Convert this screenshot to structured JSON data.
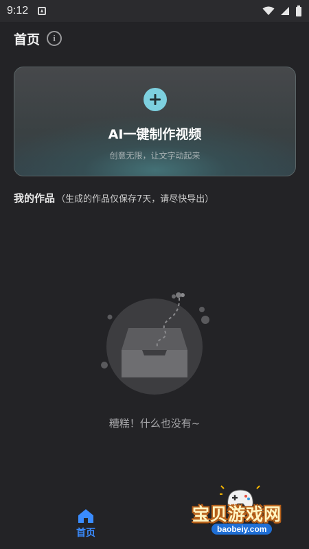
{
  "status_bar": {
    "time": "9:12",
    "icons": [
      "app-notification-icon",
      "wifi-icon",
      "signal-icon",
      "battery-icon"
    ]
  },
  "header": {
    "title": "首页",
    "info_icon": "ⓘ"
  },
  "create_card": {
    "title": "AI一键制作视频",
    "subtitle": "创意无限，让文字动起来",
    "accent_color": "#7dd0df"
  },
  "works": {
    "title": "我的作品",
    "note": "（生成的作品仅保存7天，请尽快导出）"
  },
  "empty_state": {
    "text": "糟糕！什么也没有~"
  },
  "bottom_nav": {
    "home_label": "首页",
    "active_color": "#3a8cff"
  },
  "watermark": {
    "text": "宝贝游戏网",
    "url": "baobeiy.com"
  }
}
